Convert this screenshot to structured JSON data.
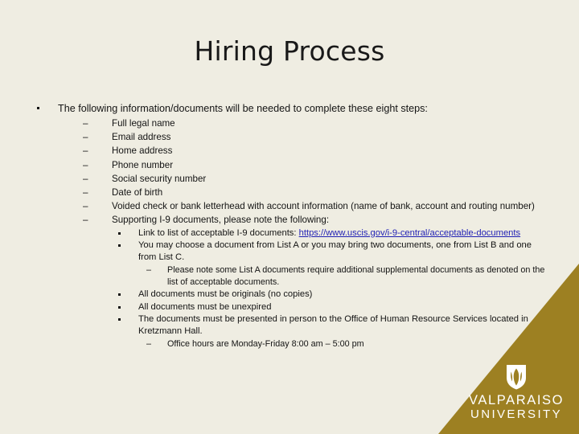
{
  "slide": {
    "title": "Hiring Process",
    "background_color": "#efede2",
    "accent_color": "#9d8022",
    "text_color": "#141414",
    "link_color": "#1f1fb4"
  },
  "intro": {
    "bullet_glyph": "square-bullet",
    "text": "The following information/documents will be needed to complete these eight steps:"
  },
  "items": [
    {
      "level": 2,
      "marker": "–",
      "text": "Full legal name"
    },
    {
      "level": 2,
      "marker": "–",
      "text": "Email address"
    },
    {
      "level": 2,
      "marker": "–",
      "text": "Home address"
    },
    {
      "level": 2,
      "marker": "–",
      "text": "Phone number"
    },
    {
      "level": 2,
      "marker": "–",
      "text": "Social security number"
    },
    {
      "level": 2,
      "marker": "–",
      "text": "Date of birth"
    },
    {
      "level": 2,
      "marker": "–",
      "text": "Voided check or bank letterhead with account information (name of bank, account and routing number)"
    },
    {
      "level": 2,
      "marker": "–",
      "text": "Supporting I-9 documents, please note the following:"
    }
  ],
  "sub_items": {
    "link_line_prefix": "Link to list of acceptable I-9 documents: ",
    "link_text": "https://www.uscis.gov/i-9-central/acceptable-documents",
    "choose_docs": "You may choose a document from List A or you may bring two documents, one from List B and one from List C.",
    "list_a_note": "Please note some List A documents require additional supplemental documents as denoted on the list of acceptable documents.",
    "originals": "All documents must be originals (no copies)",
    "unexpired": "All documents must be unexpired",
    "in_person": "The documents must be presented in person to the Office of Human Resource Services located in Kretzmann Hall.",
    "office_hours": "Office hours are Monday-Friday 8:00 am – 5:00 pm"
  },
  "branding": {
    "shield_icon": "valpo-shield-icon",
    "name": "VALPARAISO",
    "subname": "UNIVERSITY"
  }
}
